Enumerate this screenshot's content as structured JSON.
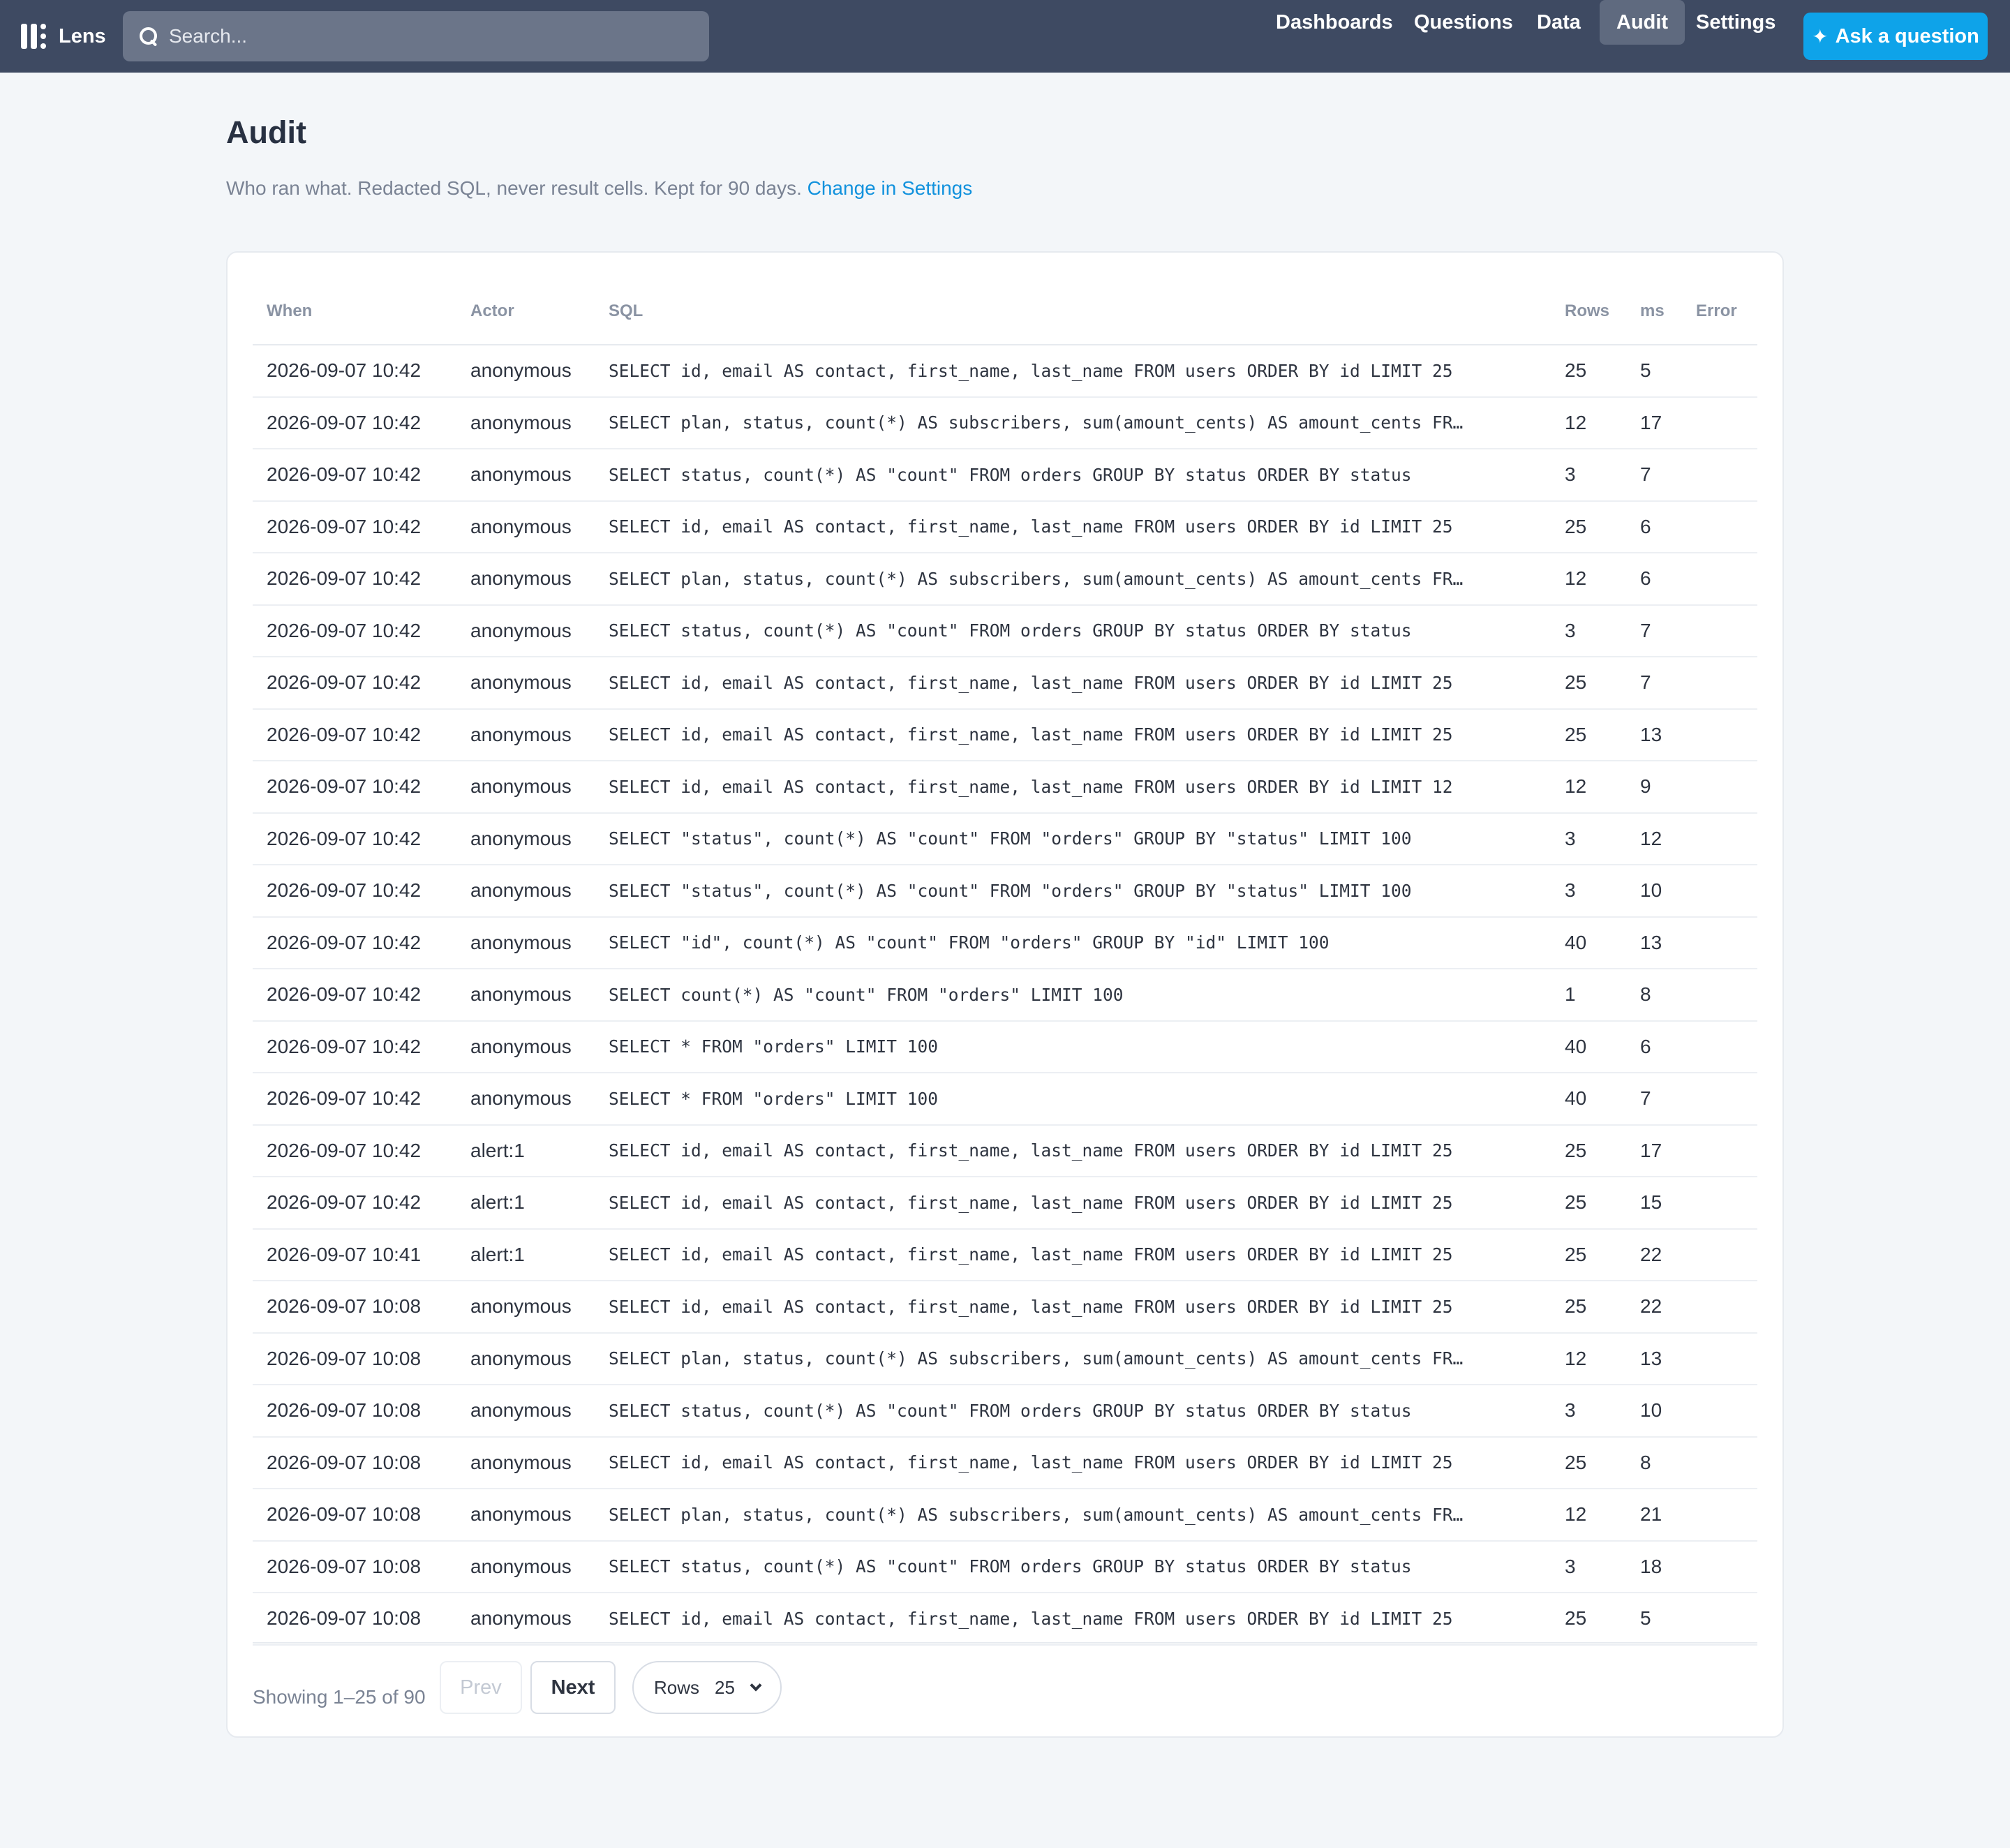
{
  "app": {
    "name": "Lens"
  },
  "search": {
    "placeholder": "Search..."
  },
  "nav": {
    "items": [
      {
        "label": "Dashboards",
        "active": false
      },
      {
        "label": "Questions",
        "active": false
      },
      {
        "label": "Data",
        "active": false
      },
      {
        "label": "Audit",
        "active": true
      },
      {
        "label": "Settings",
        "active": false
      }
    ],
    "ask_label": "Ask a question"
  },
  "page": {
    "title": "Audit",
    "subtitle": "Who ran what. Redacted SQL, never result cells. Kept for 90 days.",
    "settings_link": "Change in Settings"
  },
  "table": {
    "columns": [
      "When",
      "Actor",
      "SQL",
      "Rows",
      "ms",
      "Error"
    ],
    "rows": [
      {
        "when": "2026-09-07 10:42",
        "actor": "anonymous",
        "sql": "SELECT id, email AS contact, first_name, last_name FROM users ORDER BY id LIMIT 25",
        "rows": "25",
        "ms": "5",
        "error": ""
      },
      {
        "when": "2026-09-07 10:42",
        "actor": "anonymous",
        "sql": "SELECT plan, status, count(*) AS subscribers, sum(amount_cents) AS amount_cents FR…",
        "rows": "12",
        "ms": "17",
        "error": ""
      },
      {
        "when": "2026-09-07 10:42",
        "actor": "anonymous",
        "sql": "SELECT status, count(*) AS \"count\" FROM orders GROUP BY status ORDER BY status",
        "rows": "3",
        "ms": "7",
        "error": ""
      },
      {
        "when": "2026-09-07 10:42",
        "actor": "anonymous",
        "sql": "SELECT id, email AS contact, first_name, last_name FROM users ORDER BY id LIMIT 25",
        "rows": "25",
        "ms": "6",
        "error": ""
      },
      {
        "when": "2026-09-07 10:42",
        "actor": "anonymous",
        "sql": "SELECT plan, status, count(*) AS subscribers, sum(amount_cents) AS amount_cents FR…",
        "rows": "12",
        "ms": "6",
        "error": ""
      },
      {
        "when": "2026-09-07 10:42",
        "actor": "anonymous",
        "sql": "SELECT status, count(*) AS \"count\" FROM orders GROUP BY status ORDER BY status",
        "rows": "3",
        "ms": "7",
        "error": ""
      },
      {
        "when": "2026-09-07 10:42",
        "actor": "anonymous",
        "sql": "SELECT id, email AS contact, first_name, last_name FROM users ORDER BY id LIMIT 25",
        "rows": "25",
        "ms": "7",
        "error": ""
      },
      {
        "when": "2026-09-07 10:42",
        "actor": "anonymous",
        "sql": "SELECT id, email AS contact, first_name, last_name FROM users ORDER BY id LIMIT 25",
        "rows": "25",
        "ms": "13",
        "error": ""
      },
      {
        "when": "2026-09-07 10:42",
        "actor": "anonymous",
        "sql": "SELECT id, email AS contact, first_name, last_name FROM users ORDER BY id LIMIT 12",
        "rows": "12",
        "ms": "9",
        "error": ""
      },
      {
        "when": "2026-09-07 10:42",
        "actor": "anonymous",
        "sql": "SELECT \"status\", count(*) AS \"count\" FROM \"orders\" GROUP BY \"status\" LIMIT 100",
        "rows": "3",
        "ms": "12",
        "error": ""
      },
      {
        "when": "2026-09-07 10:42",
        "actor": "anonymous",
        "sql": "SELECT \"status\", count(*) AS \"count\" FROM \"orders\" GROUP BY \"status\" LIMIT 100",
        "rows": "3",
        "ms": "10",
        "error": ""
      },
      {
        "when": "2026-09-07 10:42",
        "actor": "anonymous",
        "sql": "SELECT \"id\", count(*) AS \"count\" FROM \"orders\" GROUP BY \"id\" LIMIT 100",
        "rows": "40",
        "ms": "13",
        "error": ""
      },
      {
        "when": "2026-09-07 10:42",
        "actor": "anonymous",
        "sql": "SELECT count(*) AS \"count\" FROM \"orders\" LIMIT 100",
        "rows": "1",
        "ms": "8",
        "error": ""
      },
      {
        "when": "2026-09-07 10:42",
        "actor": "anonymous",
        "sql": "SELECT * FROM \"orders\" LIMIT 100",
        "rows": "40",
        "ms": "6",
        "error": ""
      },
      {
        "when": "2026-09-07 10:42",
        "actor": "anonymous",
        "sql": "SELECT * FROM \"orders\" LIMIT 100",
        "rows": "40",
        "ms": "7",
        "error": ""
      },
      {
        "when": "2026-09-07 10:42",
        "actor": "alert:1",
        "sql": "SELECT id, email AS contact, first_name, last_name FROM users ORDER BY id LIMIT 25",
        "rows": "25",
        "ms": "17",
        "error": ""
      },
      {
        "when": "2026-09-07 10:42",
        "actor": "alert:1",
        "sql": "SELECT id, email AS contact, first_name, last_name FROM users ORDER BY id LIMIT 25",
        "rows": "25",
        "ms": "15",
        "error": ""
      },
      {
        "when": "2026-09-07 10:41",
        "actor": "alert:1",
        "sql": "SELECT id, email AS contact, first_name, last_name FROM users ORDER BY id LIMIT 25",
        "rows": "25",
        "ms": "22",
        "error": ""
      },
      {
        "when": "2026-09-07 10:08",
        "actor": "anonymous",
        "sql": "SELECT id, email AS contact, first_name, last_name FROM users ORDER BY id LIMIT 25",
        "rows": "25",
        "ms": "22",
        "error": ""
      },
      {
        "when": "2026-09-07 10:08",
        "actor": "anonymous",
        "sql": "SELECT plan, status, count(*) AS subscribers, sum(amount_cents) AS amount_cents FR…",
        "rows": "12",
        "ms": "13",
        "error": ""
      },
      {
        "when": "2026-09-07 10:08",
        "actor": "anonymous",
        "sql": "SELECT status, count(*) AS \"count\" FROM orders GROUP BY status ORDER BY status",
        "rows": "3",
        "ms": "10",
        "error": ""
      },
      {
        "when": "2026-09-07 10:08",
        "actor": "anonymous",
        "sql": "SELECT id, email AS contact, first_name, last_name FROM users ORDER BY id LIMIT 25",
        "rows": "25",
        "ms": "8",
        "error": ""
      },
      {
        "when": "2026-09-07 10:08",
        "actor": "anonymous",
        "sql": "SELECT plan, status, count(*) AS subscribers, sum(amount_cents) AS amount_cents FR…",
        "rows": "12",
        "ms": "21",
        "error": ""
      },
      {
        "when": "2026-09-07 10:08",
        "actor": "anonymous",
        "sql": "SELECT status, count(*) AS \"count\" FROM orders GROUP BY status ORDER BY status",
        "rows": "3",
        "ms": "18",
        "error": ""
      },
      {
        "when": "2026-09-07 10:08",
        "actor": "anonymous",
        "sql": "SELECT id, email AS contact, first_name, last_name FROM users ORDER BY id LIMIT 25",
        "rows": "25",
        "ms": "5",
        "error": ""
      }
    ]
  },
  "pagination": {
    "showing": "Showing 1–25 of 90",
    "prev_label": "Prev",
    "next_label": "Next",
    "rows_label": "Rows",
    "rows_value": "25"
  },
  "colors": {
    "topbar": "#3e4a62",
    "accent": "#0ea3e9",
    "link": "#1292dd",
    "background": "#f3f6f9"
  },
  "icons": [
    "lens-logo-icon",
    "search-icon",
    "sparkle-icon",
    "chevron-down-icon"
  ]
}
